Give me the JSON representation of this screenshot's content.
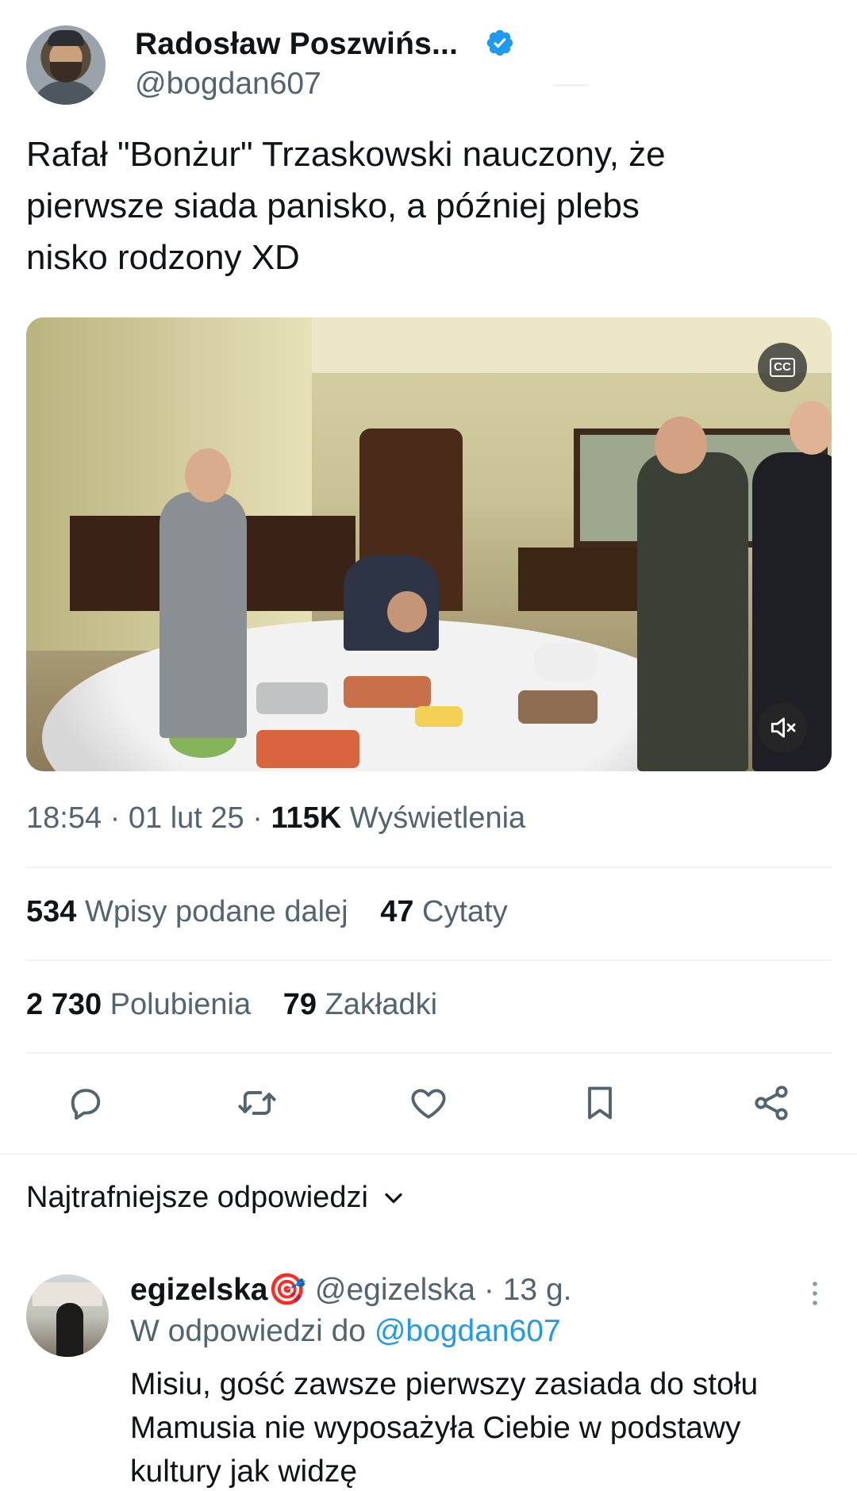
{
  "tweet": {
    "author_name": "Radosław Poszwińs...",
    "author_handle": "@bogdan607",
    "verified_icon": "verified-badge-icon",
    "text": "Rafał \"Bonżur\" Trzaskowski nauczony, że\npierwsze siada panisko, a później plebs\nnisko rodzony XD",
    "time": "18:54",
    "date": "01 lut 25",
    "views_count": "115K",
    "views_label": "Wyświetlenia",
    "separator": "·"
  },
  "media": {
    "type": "video",
    "cc_label": "CC",
    "cc_icon": "closed-captions-icon",
    "mute_icon": "muted-speaker-icon"
  },
  "stats": {
    "retweets_count": "534",
    "retweets_label": "Wpisy podane dalej",
    "quotes_count": "47",
    "quotes_label": "Cytaty",
    "likes_count": "2 730",
    "likes_label": "Polubienia",
    "bookmarks_count": "79",
    "bookmarks_label": "Zakładki"
  },
  "actions": [
    {
      "icon": "reply-icon"
    },
    {
      "icon": "retweet-icon"
    },
    {
      "icon": "like-heart-icon"
    },
    {
      "icon": "bookmark-icon"
    },
    {
      "icon": "share-icon"
    }
  ],
  "replies": {
    "sort_label": "Najtrafniejsze odpowiedzi",
    "items": [
      {
        "name": "egizelska🎯",
        "handle": "@egizelska",
        "age": "13 g.",
        "reply_to_label": "W odpowiedzi do",
        "reply_to_handle": "@bogdan607",
        "text": "Misiu, gość zawsze pierwszy zasiada do stołu\nMamusia nie wyposażyła Ciebie w podstawy\nkultury jak widzę"
      }
    ]
  },
  "colors": {
    "text_primary": "#0f1419",
    "text_secondary": "#536471",
    "accent": "#1d9bf0",
    "divider": "#eff3f4"
  }
}
